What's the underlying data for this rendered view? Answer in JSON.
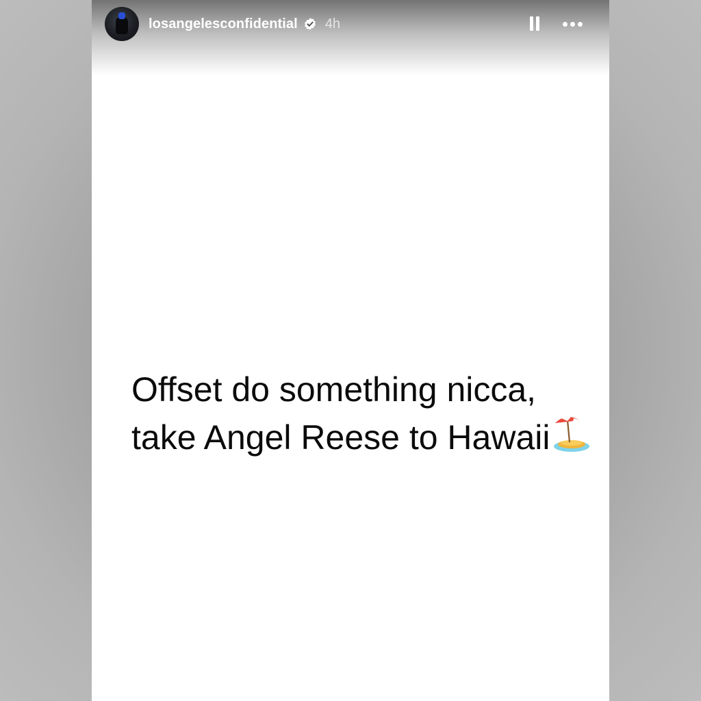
{
  "story": {
    "username": "losangelesconfidential",
    "verified": true,
    "timestamp": "4h",
    "text": "Offset do something nicca, take Angel Reese to Hawaii",
    "text_emoji": "beach-with-umbrella-icon"
  },
  "controls": {
    "pause_icon": "pause-icon",
    "more_icon": "more-options-icon"
  },
  "colors": {
    "story_background": "#ffffff",
    "text": "#0b0b0b",
    "verified_badge": "#ffffff"
  }
}
